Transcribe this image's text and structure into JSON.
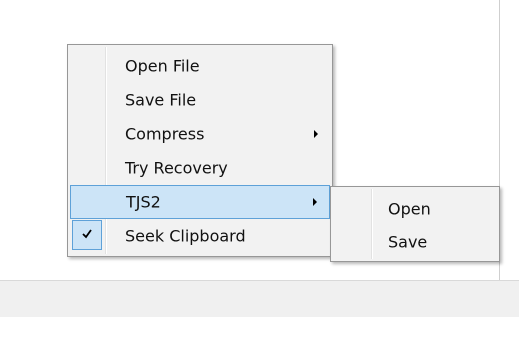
{
  "context_menu": {
    "items": [
      {
        "label": "Open File"
      },
      {
        "label": "Save File"
      },
      {
        "label": "Compress"
      },
      {
        "label": "Try Recovery"
      },
      {
        "label": "TJS2"
      },
      {
        "label": "Seek Clipboard"
      }
    ]
  },
  "submenu_tjs2": {
    "items": [
      {
        "label": "Open"
      },
      {
        "label": "Save"
      }
    ]
  },
  "colors": {
    "menu_background": "#f2f2f2",
    "menu_border": "#979797",
    "highlight_fill": "#cce4f7",
    "highlight_border": "#5ea1d8",
    "status_band": "#f0f0f0"
  },
  "icons": {
    "submenu_arrow": "chevron-right-icon",
    "check": "check-icon"
  }
}
